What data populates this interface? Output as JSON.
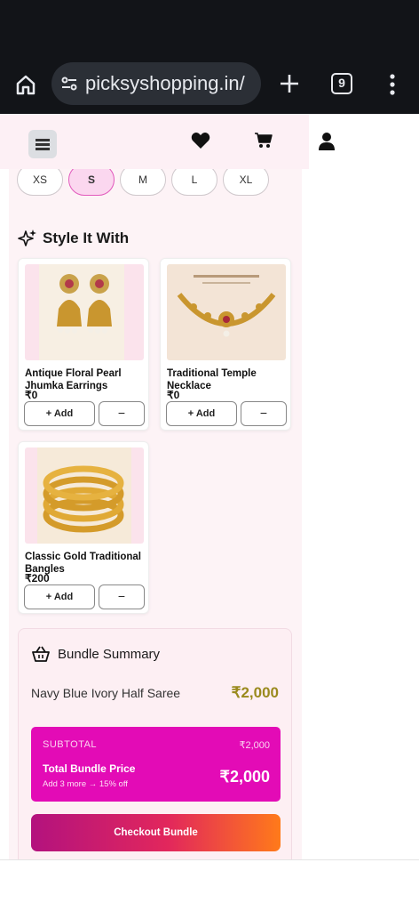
{
  "browser": {
    "url": "picksyshopping.in/",
    "tab_count": "9"
  },
  "sizes": [
    {
      "label": "XS",
      "selected": false
    },
    {
      "label": "S",
      "selected": true
    },
    {
      "label": "M",
      "selected": false
    },
    {
      "label": "L",
      "selected": false
    },
    {
      "label": "XL",
      "selected": false
    }
  ],
  "style_section": {
    "title": "Style It With"
  },
  "products": [
    {
      "name": "Antique Floral Pearl Jhumka Earrings",
      "price": "₹0",
      "add_label": "+ Add",
      "minus_label": "−"
    },
    {
      "name": "Traditional Temple Necklace",
      "price": "₹0",
      "add_label": "+ Add",
      "minus_label": "−"
    },
    {
      "name": "Classic Gold Traditional Bangles",
      "price": "₹200",
      "add_label": "+ Add",
      "minus_label": "−"
    }
  ],
  "bundle": {
    "title": "Bundle Summary",
    "item_name": "Navy Blue Ivory Half Saree",
    "item_price": "₹2,000",
    "subtotal_label": "SUBTOTAL",
    "subtotal_value": "₹2,000",
    "total_label": "Total Bundle Price",
    "total_note": "Add 3 more → 15% off",
    "total_value": "₹2,000",
    "checkout_label": "Checkout Bundle"
  },
  "colors": {
    "accent_pink": "#e30bb6",
    "price_gold": "#9a8a1d",
    "header_bg": "#fdf0f5"
  }
}
